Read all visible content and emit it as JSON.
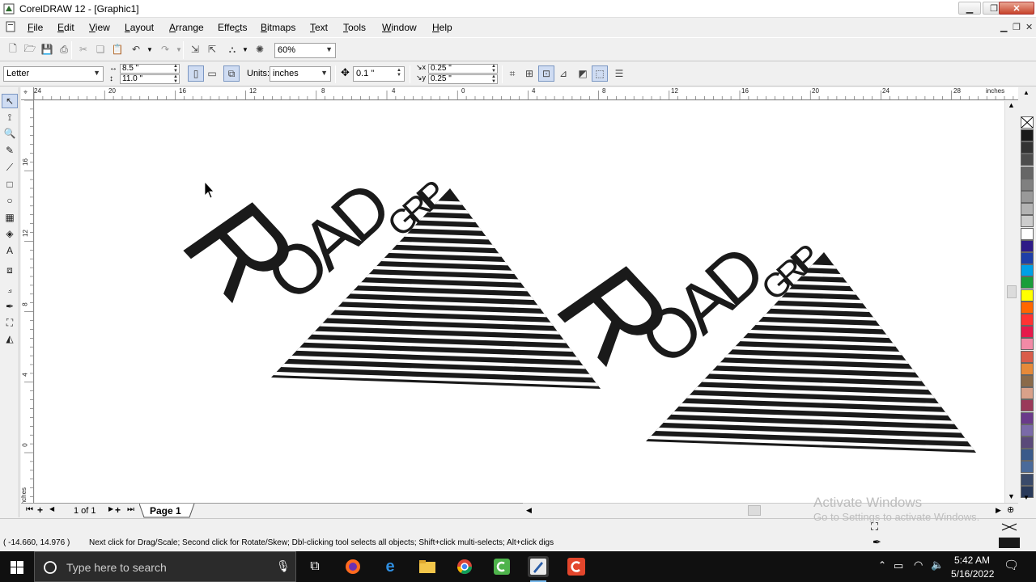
{
  "window": {
    "title": "CorelDRAW 12 - [Graphic1]"
  },
  "menu": [
    {
      "label": "File",
      "ul": "F",
      "rest": "ile"
    },
    {
      "label": "Edit",
      "ul": "E",
      "rest": "dit"
    },
    {
      "label": "View",
      "ul": "V",
      "rest": "iew"
    },
    {
      "label": "Layout",
      "ul": "L",
      "rest": "ayout"
    },
    {
      "label": "Arrange",
      "ul": "A",
      "rest": "rrange"
    },
    {
      "label": "Effects",
      "ul": "",
      "pre": "Effe",
      "ul2": "c",
      "rest": "ts"
    },
    {
      "label": "Bitmaps",
      "ul": "B",
      "rest": "itmaps"
    },
    {
      "label": "Text",
      "ul": "T",
      "rest": "ext"
    },
    {
      "label": "Tools",
      "ul": "T",
      "rest": "ools"
    },
    {
      "label": "Window",
      "ul": "W",
      "rest": "indow"
    },
    {
      "label": "Help",
      "ul": "H",
      "rest": "elp"
    }
  ],
  "toolbar": {
    "zoom": "60%",
    "paper": "Letter",
    "width": "8.5 \"",
    "height": "11.0 \"",
    "units_label": "Units:",
    "units": "inches",
    "nudge": "0.1 \"",
    "dup_x": "0.25 \"",
    "dup_y": "0.25 \""
  },
  "rulers": {
    "h_ticks": [
      "24",
      "20",
      "16",
      "12",
      "8",
      "4",
      "0",
      "4",
      "8",
      "12",
      "16",
      "20",
      "24",
      "28"
    ],
    "h_unit": "inches",
    "v_ticks": [
      "16",
      "12",
      "8",
      "4",
      "0"
    ],
    "v_unit": "inches"
  },
  "artwork": {
    "logo_text_large": "R",
    "logo_text_road": "OAD",
    "logo_text_grip": "GRIP"
  },
  "palette": {
    "colors": [
      "#1a1a1a",
      "#333333",
      "#4d4d4d",
      "#666666",
      "#808080",
      "#999999",
      "#b3b3b3",
      "#cccccc",
      "#ffffff",
      "#2e1a87",
      "#1e3fa8",
      "#00a0e6",
      "#1a9e3a",
      "#ffff00",
      "#ff6600",
      "#ff3333",
      "#e6194b",
      "#f28aa6",
      "#d95c4a",
      "#e68a3a",
      "#8a6a4a",
      "#d9a18a",
      "#9a3a5a",
      "#6a3a8a",
      "#7a6aa8",
      "#5a4a7a",
      "#3a5a8a",
      "#4a6a9a",
      "#3a4a6a",
      "#2a3a5a"
    ]
  },
  "pagebar": {
    "counter": "1 of 1",
    "tab": "Page 1"
  },
  "status": {
    "coords": "( -14.660, 14.976 )",
    "hint": "Next click for Drag/Scale; Second click for Rotate/Skew; Dbl-clicking tool selects all objects; Shift+click multi-selects; Alt+click digs"
  },
  "watermark": {
    "line1": "Activate Windows",
    "line2": "Go to Settings to activate Windows."
  },
  "taskbar": {
    "search_placeholder": "Type here to search",
    "time": "5:42 AM",
    "date": "5/16/2022"
  }
}
